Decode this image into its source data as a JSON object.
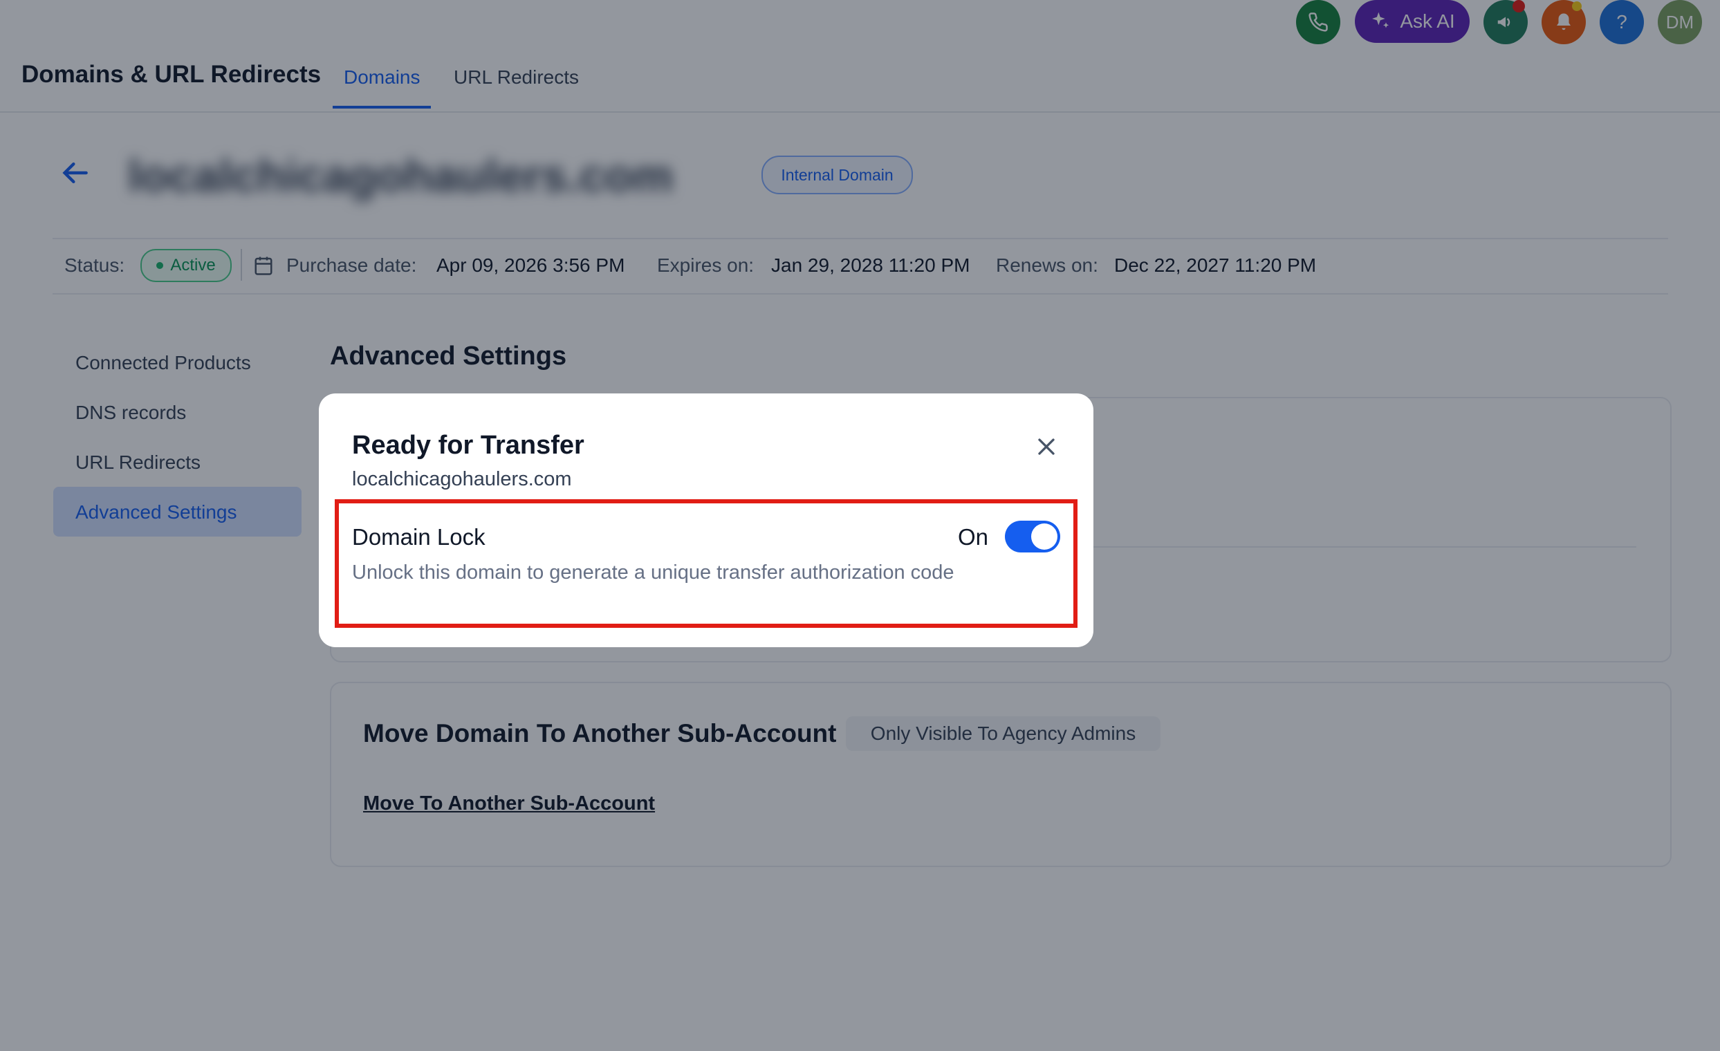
{
  "header": {
    "app_title": "Domains & URL Redirects",
    "tabs": [
      {
        "label": "Domains",
        "active": true
      },
      {
        "label": "URL Redirects",
        "active": false
      }
    ],
    "ask_ai_label": "Ask AI",
    "help_label": "?",
    "avatar_initials": "DM"
  },
  "domain": {
    "name": "localchicagohaulers.com",
    "badge": "Internal Domain"
  },
  "status_row": {
    "status_label": "Status:",
    "status_value": "Active",
    "purchase_label": "Purchase date:",
    "purchase_value": "Apr 09, 2026 3:56 PM",
    "expires_label": "Expires on:",
    "expires_value": "Jan 29, 2028 11:20 PM",
    "renews_label": "Renews on:",
    "renews_value": "Dec 22, 2027 11:20 PM"
  },
  "sidebar": {
    "items": [
      {
        "label": "Connected Products",
        "active": false
      },
      {
        "label": "DNS records",
        "active": false
      },
      {
        "label": "URL Redirects",
        "active": false
      },
      {
        "label": "Advanced Settings",
        "active": true
      }
    ]
  },
  "main": {
    "section_title": "Advanced Settings",
    "move_card": {
      "title": "Move Domain To Another Sub-Account",
      "badge": "Only Visible To Agency Admins",
      "link": "Move To Another Sub-Account"
    }
  },
  "modal": {
    "title": "Ready for Transfer",
    "subtitle": "localchicagohaulers.com",
    "lock_title": "Domain Lock",
    "lock_description": "Unlock this domain to generate a unique transfer authorization code",
    "toggle_label": "On",
    "toggle_on": true
  },
  "colors": {
    "brand_blue": "#155eef",
    "ask_ai_purple": "#5b21b6",
    "phone_green": "#15803d",
    "highlight_red": "#e11d15"
  }
}
